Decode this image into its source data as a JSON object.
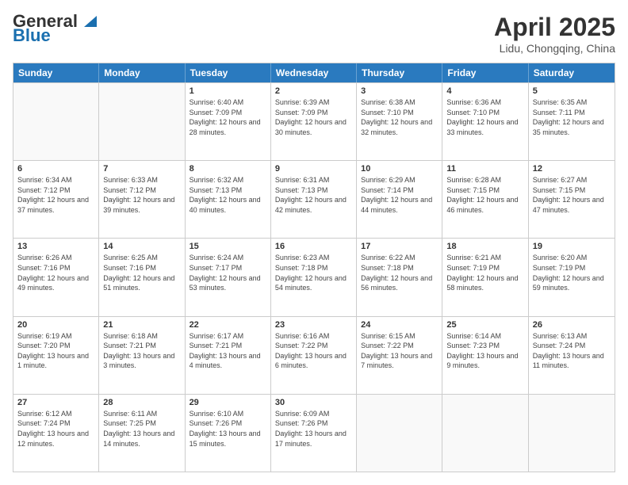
{
  "logo": {
    "general": "General",
    "blue": "Blue"
  },
  "title": "April 2025",
  "subtitle": "Lidu, Chongqing, China",
  "days_header": [
    "Sunday",
    "Monday",
    "Tuesday",
    "Wednesday",
    "Thursday",
    "Friday",
    "Saturday"
  ],
  "weeks": [
    [
      {
        "day": "",
        "info": ""
      },
      {
        "day": "",
        "info": ""
      },
      {
        "day": "1",
        "info": "Sunrise: 6:40 AM\nSunset: 7:09 PM\nDaylight: 12 hours and 28 minutes."
      },
      {
        "day": "2",
        "info": "Sunrise: 6:39 AM\nSunset: 7:09 PM\nDaylight: 12 hours and 30 minutes."
      },
      {
        "day": "3",
        "info": "Sunrise: 6:38 AM\nSunset: 7:10 PM\nDaylight: 12 hours and 32 minutes."
      },
      {
        "day": "4",
        "info": "Sunrise: 6:36 AM\nSunset: 7:10 PM\nDaylight: 12 hours and 33 minutes."
      },
      {
        "day": "5",
        "info": "Sunrise: 6:35 AM\nSunset: 7:11 PM\nDaylight: 12 hours and 35 minutes."
      }
    ],
    [
      {
        "day": "6",
        "info": "Sunrise: 6:34 AM\nSunset: 7:12 PM\nDaylight: 12 hours and 37 minutes."
      },
      {
        "day": "7",
        "info": "Sunrise: 6:33 AM\nSunset: 7:12 PM\nDaylight: 12 hours and 39 minutes."
      },
      {
        "day": "8",
        "info": "Sunrise: 6:32 AM\nSunset: 7:13 PM\nDaylight: 12 hours and 40 minutes."
      },
      {
        "day": "9",
        "info": "Sunrise: 6:31 AM\nSunset: 7:13 PM\nDaylight: 12 hours and 42 minutes."
      },
      {
        "day": "10",
        "info": "Sunrise: 6:29 AM\nSunset: 7:14 PM\nDaylight: 12 hours and 44 minutes."
      },
      {
        "day": "11",
        "info": "Sunrise: 6:28 AM\nSunset: 7:15 PM\nDaylight: 12 hours and 46 minutes."
      },
      {
        "day": "12",
        "info": "Sunrise: 6:27 AM\nSunset: 7:15 PM\nDaylight: 12 hours and 47 minutes."
      }
    ],
    [
      {
        "day": "13",
        "info": "Sunrise: 6:26 AM\nSunset: 7:16 PM\nDaylight: 12 hours and 49 minutes."
      },
      {
        "day": "14",
        "info": "Sunrise: 6:25 AM\nSunset: 7:16 PM\nDaylight: 12 hours and 51 minutes."
      },
      {
        "day": "15",
        "info": "Sunrise: 6:24 AM\nSunset: 7:17 PM\nDaylight: 12 hours and 53 minutes."
      },
      {
        "day": "16",
        "info": "Sunrise: 6:23 AM\nSunset: 7:18 PM\nDaylight: 12 hours and 54 minutes."
      },
      {
        "day": "17",
        "info": "Sunrise: 6:22 AM\nSunset: 7:18 PM\nDaylight: 12 hours and 56 minutes."
      },
      {
        "day": "18",
        "info": "Sunrise: 6:21 AM\nSunset: 7:19 PM\nDaylight: 12 hours and 58 minutes."
      },
      {
        "day": "19",
        "info": "Sunrise: 6:20 AM\nSunset: 7:19 PM\nDaylight: 12 hours and 59 minutes."
      }
    ],
    [
      {
        "day": "20",
        "info": "Sunrise: 6:19 AM\nSunset: 7:20 PM\nDaylight: 13 hours and 1 minute."
      },
      {
        "day": "21",
        "info": "Sunrise: 6:18 AM\nSunset: 7:21 PM\nDaylight: 13 hours and 3 minutes."
      },
      {
        "day": "22",
        "info": "Sunrise: 6:17 AM\nSunset: 7:21 PM\nDaylight: 13 hours and 4 minutes."
      },
      {
        "day": "23",
        "info": "Sunrise: 6:16 AM\nSunset: 7:22 PM\nDaylight: 13 hours and 6 minutes."
      },
      {
        "day": "24",
        "info": "Sunrise: 6:15 AM\nSunset: 7:22 PM\nDaylight: 13 hours and 7 minutes."
      },
      {
        "day": "25",
        "info": "Sunrise: 6:14 AM\nSunset: 7:23 PM\nDaylight: 13 hours and 9 minutes."
      },
      {
        "day": "26",
        "info": "Sunrise: 6:13 AM\nSunset: 7:24 PM\nDaylight: 13 hours and 11 minutes."
      }
    ],
    [
      {
        "day": "27",
        "info": "Sunrise: 6:12 AM\nSunset: 7:24 PM\nDaylight: 13 hours and 12 minutes."
      },
      {
        "day": "28",
        "info": "Sunrise: 6:11 AM\nSunset: 7:25 PM\nDaylight: 13 hours and 14 minutes."
      },
      {
        "day": "29",
        "info": "Sunrise: 6:10 AM\nSunset: 7:26 PM\nDaylight: 13 hours and 15 minutes."
      },
      {
        "day": "30",
        "info": "Sunrise: 6:09 AM\nSunset: 7:26 PM\nDaylight: 13 hours and 17 minutes."
      },
      {
        "day": "",
        "info": ""
      },
      {
        "day": "",
        "info": ""
      },
      {
        "day": "",
        "info": ""
      }
    ]
  ]
}
